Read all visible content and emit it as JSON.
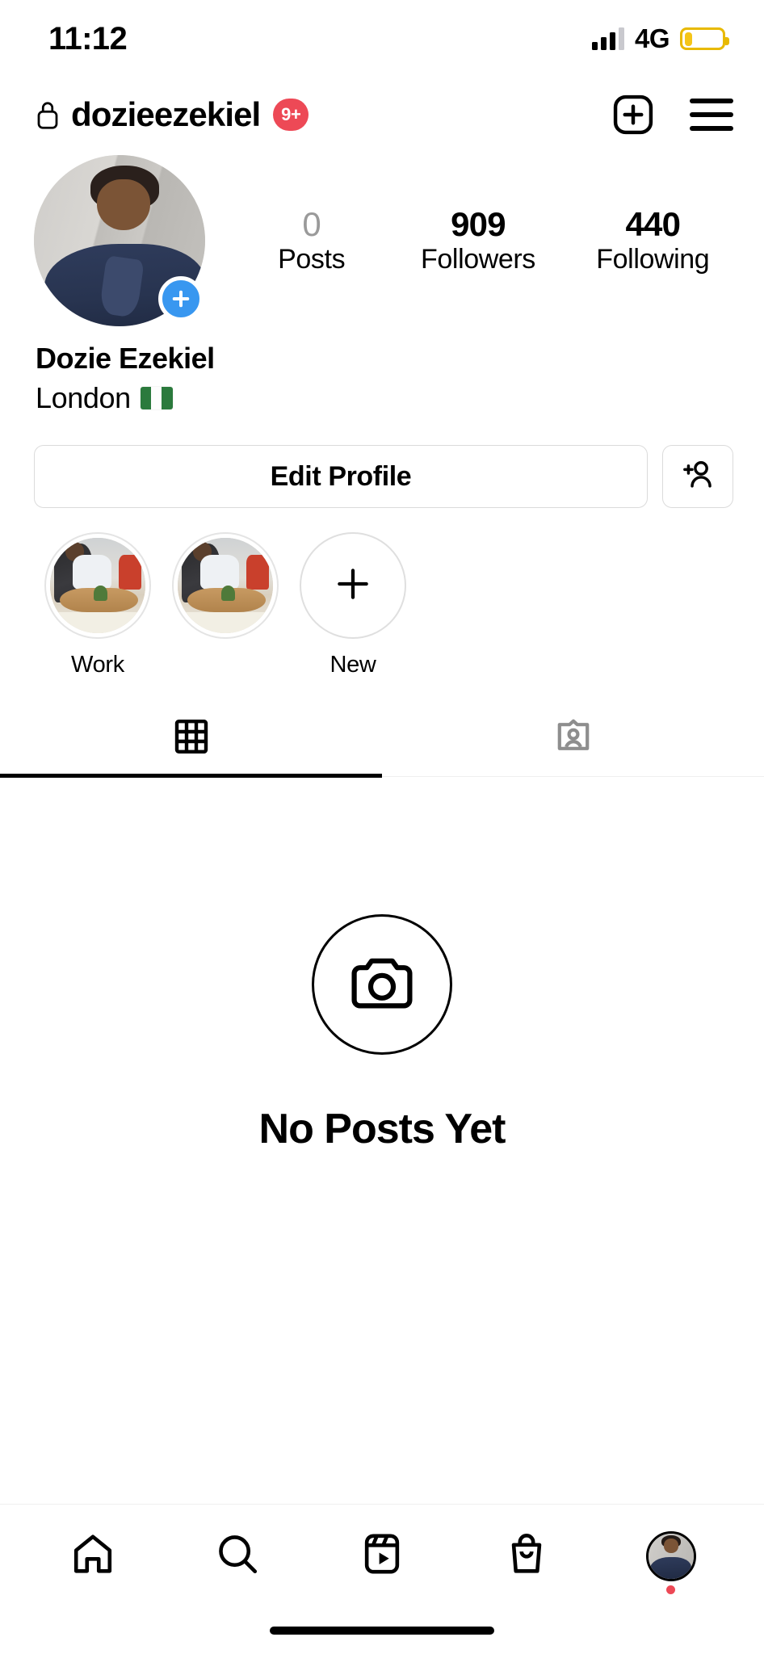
{
  "status_bar": {
    "time": "11:12",
    "network": "4G",
    "signal_icon": "signal-bars-icon",
    "battery_icon": "battery-low-icon",
    "battery_level_percent": 22
  },
  "header": {
    "lock_icon": "lock-icon",
    "username": "dozieezekiel",
    "notification_badge": "9+",
    "badge_color": "#ED4956",
    "new_post_icon": "plus-square-icon",
    "menu_icon": "hamburger-menu-icon"
  },
  "profile": {
    "avatar_name": "profile-avatar",
    "avatar_add_story_icon": "plus-circle-icon",
    "add_story_color": "#3897F0",
    "full_name": "Dozie Ezekiel",
    "bio_line": "London",
    "bio_flag": "nigeria-flag",
    "stats": [
      {
        "key": "posts",
        "value": "0",
        "label": "Posts",
        "dimmed": true
      },
      {
        "key": "followers",
        "value": "909",
        "label": "Followers",
        "dimmed": false
      },
      {
        "key": "following",
        "value": "440",
        "label": "Following",
        "dimmed": false
      }
    ]
  },
  "actions": {
    "edit_profile_label": "Edit Profile",
    "add_person_icon": "add-person-icon"
  },
  "highlights": [
    {
      "label": "Work",
      "type": "image",
      "name": "story-highlight-work"
    },
    {
      "label": "",
      "type": "image",
      "name": "story-highlight-untitled"
    },
    {
      "label": "New",
      "type": "new",
      "name": "story-highlight-new"
    }
  ],
  "tabs": [
    {
      "key": "grid",
      "icon": "grid-icon",
      "active": true
    },
    {
      "key": "tagged",
      "icon": "tagged-person-icon",
      "active": false
    }
  ],
  "empty_state": {
    "icon": "camera-icon",
    "title": "No Posts Yet"
  },
  "bottom_nav": [
    {
      "key": "home",
      "icon": "home-icon",
      "active": false
    },
    {
      "key": "search",
      "icon": "search-icon",
      "active": false
    },
    {
      "key": "reels",
      "icon": "reels-icon",
      "active": false
    },
    {
      "key": "shop",
      "icon": "shop-bag-icon",
      "active": false
    },
    {
      "key": "profile",
      "icon": "profile-avatar-icon",
      "active": true,
      "has_dot": true
    }
  ],
  "home_indicator": "home-indicator-bar"
}
